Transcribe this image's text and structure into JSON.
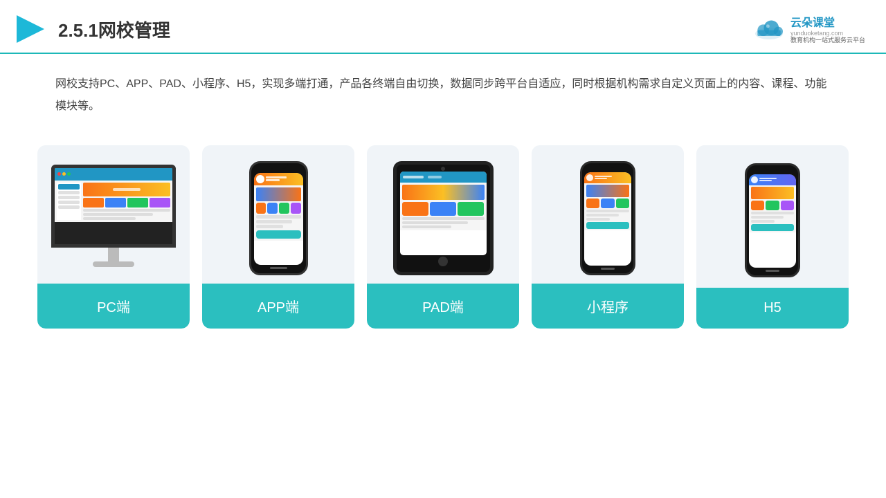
{
  "header": {
    "title": "2.5.1网校管理",
    "brand": {
      "name": "云朵课堂",
      "url": "yunduoketang.com",
      "tagline": "教育机构一站\n式服务云平台"
    }
  },
  "description": {
    "text": "网校支持PC、APP、PAD、小程序、H5，实现多端打通，产品各终端自由切换，数据同步跨平台自适应，同时根据机构需求自定义页面上的内容、课程、功能模块等。"
  },
  "cards": [
    {
      "id": "pc",
      "label": "PC端"
    },
    {
      "id": "app",
      "label": "APP端"
    },
    {
      "id": "pad",
      "label": "PAD端"
    },
    {
      "id": "miniprogram",
      "label": "小程序"
    },
    {
      "id": "h5",
      "label": "H5"
    }
  ],
  "colors": {
    "teal": "#2bbfbf",
    "blue": "#2196c4",
    "orange": "#f97316",
    "accent": "#1db8b8"
  }
}
